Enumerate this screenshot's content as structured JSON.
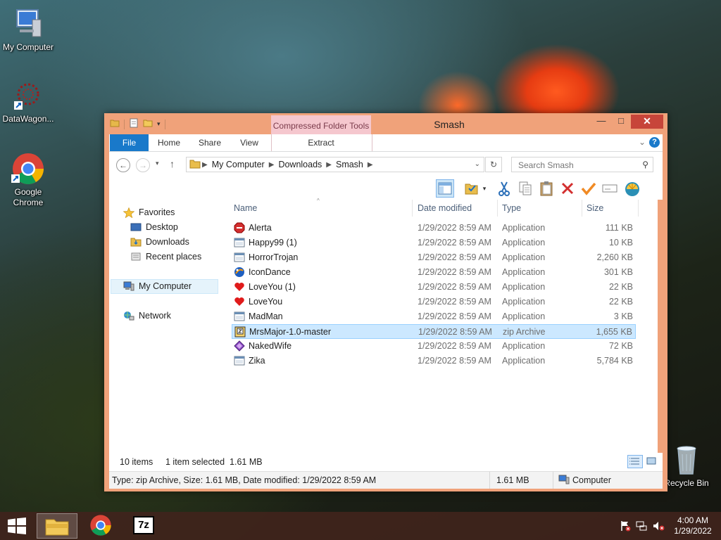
{
  "desktop": {
    "icons": [
      {
        "label": "My Computer"
      },
      {
        "label": "DataWagon..."
      },
      {
        "label": "Google Chrome"
      },
      {
        "label": "Recycle Bin"
      }
    ]
  },
  "window": {
    "title": "Smash",
    "context_tab": "Compressed Folder Tools",
    "ribbon_tabs": [
      "File",
      "Home",
      "Share",
      "View",
      "Extract"
    ],
    "address": {
      "path": [
        "My Computer",
        "Downloads",
        "Smash"
      ],
      "search_placeholder": "Search Smash"
    },
    "nav": {
      "favorites": "Favorites",
      "desktop": "Desktop",
      "downloads": "Downloads",
      "recent": "Recent places",
      "computer": "My Computer",
      "network": "Network"
    },
    "columns": {
      "name": "Name",
      "date": "Date modified",
      "type": "Type",
      "size": "Size"
    },
    "files": [
      {
        "name": "Alerta",
        "date": "1/29/2022 8:59 AM",
        "type": "Application",
        "size": "111 KB",
        "icon": "stop-icon"
      },
      {
        "name": "Happy99 (1)",
        "date": "1/29/2022 8:59 AM",
        "type": "Application",
        "size": "10 KB",
        "icon": "app-window-icon"
      },
      {
        "name": "HorrorTrojan",
        "date": "1/29/2022 8:59 AM",
        "type": "Application",
        "size": "2,260 KB",
        "icon": "app-window-icon"
      },
      {
        "name": "IconDance",
        "date": "1/29/2022 8:59 AM",
        "type": "Application",
        "size": "301 KB",
        "icon": "globe-icon"
      },
      {
        "name": "LoveYou (1)",
        "date": "1/29/2022 8:59 AM",
        "type": "Application",
        "size": "22 KB",
        "icon": "heart-icon"
      },
      {
        "name": "LoveYou",
        "date": "1/29/2022 8:59 AM",
        "type": "Application",
        "size": "22 KB",
        "icon": "heart-icon"
      },
      {
        "name": "MadMan",
        "date": "1/29/2022 8:59 AM",
        "type": "Application",
        "size": "3 KB",
        "icon": "app-window-icon"
      },
      {
        "name": "MrsMajor-1.0-master",
        "date": "1/29/2022 8:59 AM",
        "type": "zip Archive",
        "size": "1,655 KB",
        "icon": "zip-folder-icon",
        "selected": true
      },
      {
        "name": "NakedWife",
        "date": "1/29/2022 8:59 AM",
        "type": "Application",
        "size": "72 KB",
        "icon": "diamond-icon"
      },
      {
        "name": "Zika",
        "date": "1/29/2022 8:59 AM",
        "type": "Application",
        "size": "5,784 KB",
        "icon": "app-window-icon"
      }
    ],
    "status": {
      "items": "10 items",
      "selected": "1 item selected  1.61 MB"
    },
    "details": {
      "text": "Type: zip Archive, Size: 1.61 MB, Date modified: 1/29/2022 8:59 AM",
      "size": "1.61 MB",
      "location": "Computer"
    }
  },
  "taskbar": {
    "clock_time": "4:00 AM",
    "clock_date": "1/29/2022",
    "sevenzip_label": "7z"
  },
  "colors": {
    "window_frame": "#f0a27a",
    "file_tab": "#1979ca",
    "close_button": "#c7453a",
    "selection": "#cce8ff",
    "context_tab": "#f5c7ce"
  }
}
